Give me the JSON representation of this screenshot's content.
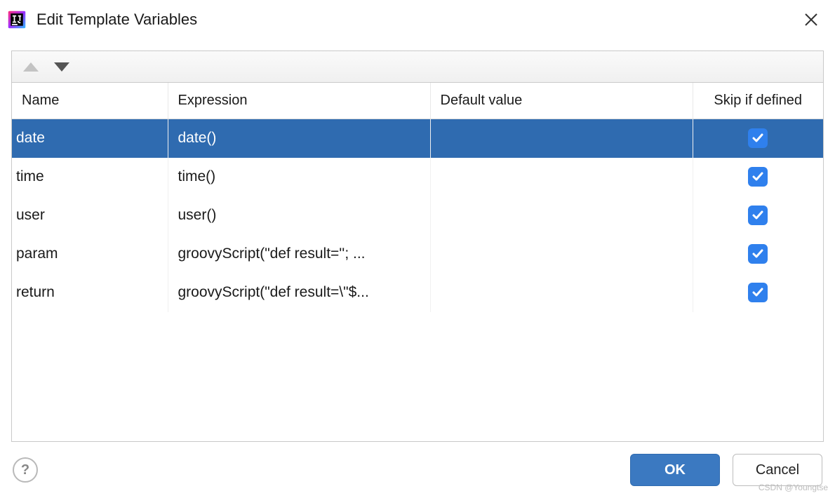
{
  "title": "Edit Template Variables",
  "columns": {
    "name": "Name",
    "expression": "Expression",
    "default_value": "Default value",
    "skip_if_defined": "Skip if defined"
  },
  "rows": [
    {
      "name": "date",
      "expression": "date()",
      "default_value": "",
      "skip": true,
      "selected": true
    },
    {
      "name": "time",
      "expression": "time()",
      "default_value": "",
      "skip": true,
      "selected": false
    },
    {
      "name": "user",
      "expression": "user()",
      "default_value": "",
      "skip": true,
      "selected": false
    },
    {
      "name": "param",
      "expression": "groovyScript(\"def result=''; ...",
      "default_value": "",
      "skip": true,
      "selected": false
    },
    {
      "name": "return",
      "expression": "groovyScript(\"def result=\\\"$...",
      "default_value": "",
      "skip": true,
      "selected": false
    }
  ],
  "buttons": {
    "ok": "OK",
    "cancel": "Cancel"
  },
  "help_symbol": "?",
  "watermark": "CSDN @Youngtse"
}
